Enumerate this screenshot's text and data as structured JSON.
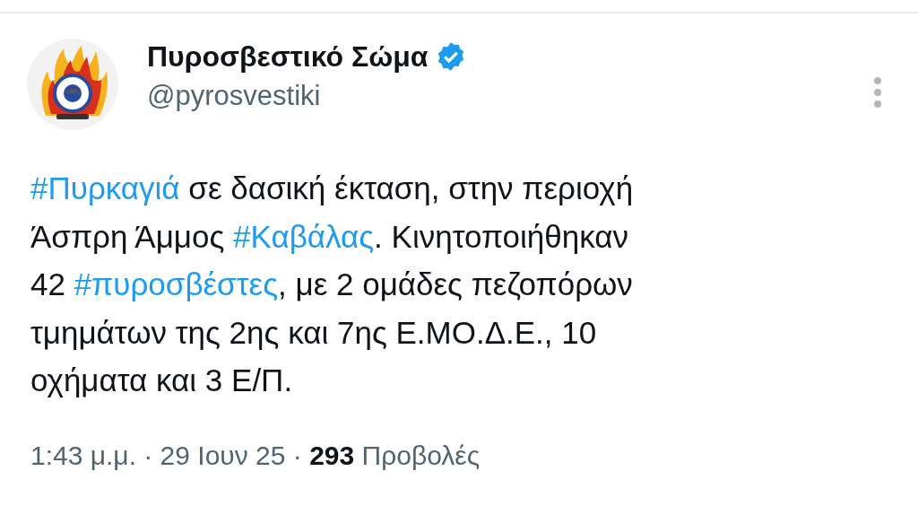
{
  "author": {
    "name": "Πυροσβεστικό Σώμα",
    "verified": true,
    "handle": "@pyrosvestiki"
  },
  "body": {
    "lines": [
      [
        {
          "kind": "hashtag",
          "text": "#Πυρκαγιά"
        },
        {
          "kind": "plain",
          "text": " σε δασική έκταση, στην περιοχή"
        }
      ],
      [
        {
          "kind": "plain",
          "text": "Άσπρη Άμμος "
        },
        {
          "kind": "hashtag",
          "text": "#Καβάλας"
        },
        {
          "kind": "plain",
          "text": ". Κινητοποιήθηκαν"
        }
      ],
      [
        {
          "kind": "plain",
          "text": "42 "
        },
        {
          "kind": "hashtag",
          "text": "#πυροσβέστες"
        },
        {
          "kind": "plain",
          "text": ", με 2 ομάδες πεζοπόρων"
        }
      ],
      [
        {
          "kind": "plain",
          "text": "τμημάτων της 2ης και 7ης Ε.ΜΟ.Δ.Ε., 10"
        }
      ],
      [
        {
          "kind": "plain",
          "text": "οχήματα και 3 Ε/Π."
        }
      ]
    ]
  },
  "meta": "1:43 μ.μ. · 29 Ιουν 25 · **293** Προβολές"
}
